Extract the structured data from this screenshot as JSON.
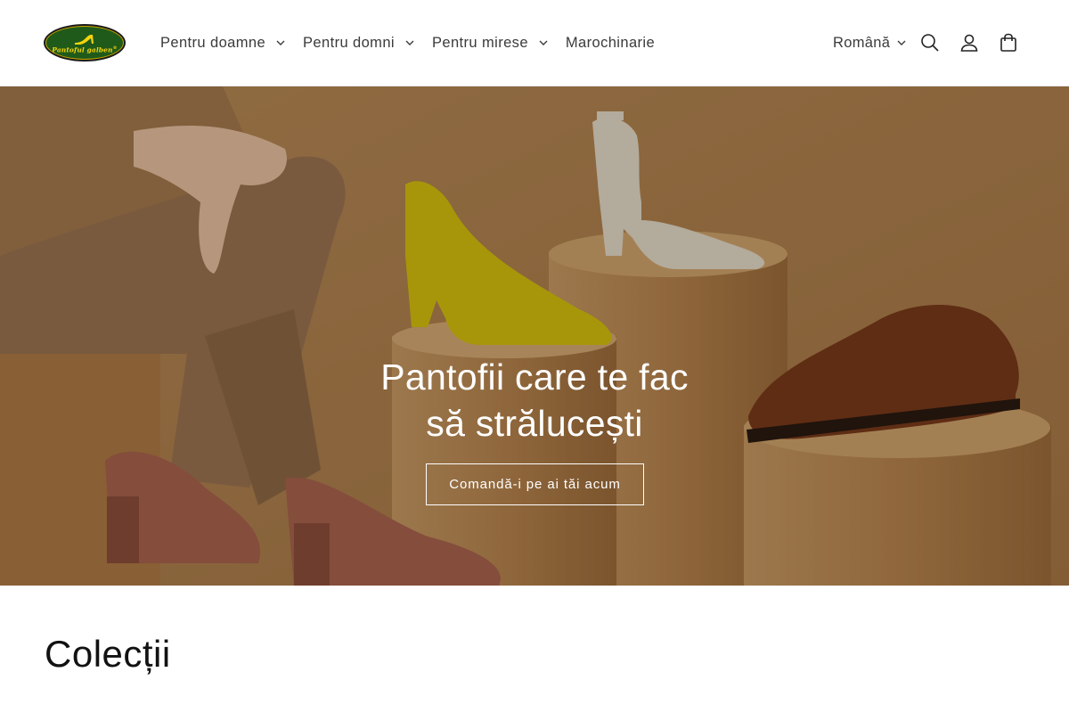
{
  "brand": {
    "logo_text": "Pantoful galben",
    "logo_mark": "®"
  },
  "nav": {
    "items": [
      {
        "label": "Pentru doamne",
        "has_dropdown": true
      },
      {
        "label": "Pentru domni",
        "has_dropdown": true
      },
      {
        "label": "Pentru mirese",
        "has_dropdown": true
      },
      {
        "label": "Marochinarie",
        "has_dropdown": false
      }
    ]
  },
  "header": {
    "language": "Română",
    "icons": [
      "search-icon",
      "account-icon",
      "cart-icon"
    ]
  },
  "hero": {
    "title_line1": "Pantofii care te fac",
    "title_line2": "să strălucești",
    "cta_label": "Comandă-i pe ai tăi acum"
  },
  "collections": {
    "title": "Colecții"
  },
  "colors": {
    "text": "#121212",
    "nav_text": "#3b3b3b",
    "hero_bg": "#b98a55",
    "logo_green": "#1f5a1a",
    "logo_yellow": "#f5d40b"
  }
}
